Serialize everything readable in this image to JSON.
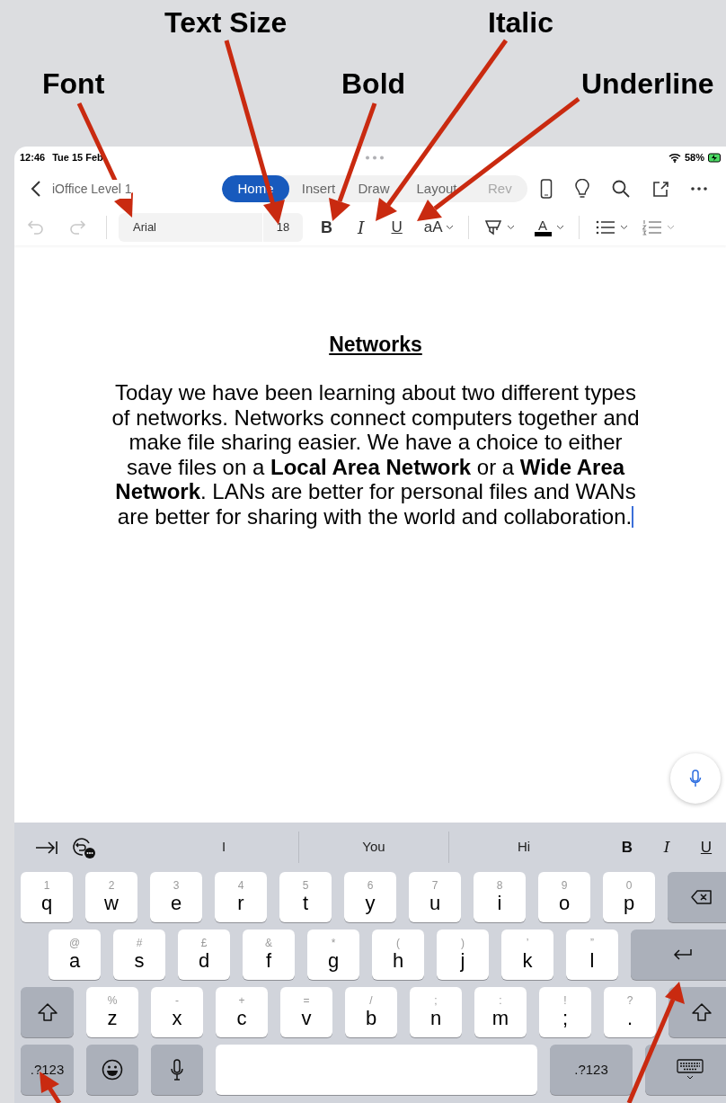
{
  "annotations": [
    {
      "label": "Text Size",
      "kind": "top"
    },
    {
      "label": "Italic",
      "kind": "top"
    },
    {
      "label": "Font",
      "kind": "low"
    },
    {
      "label": "Bold",
      "kind": "low"
    },
    {
      "label": "Underline",
      "kind": "low"
    }
  ],
  "status_bar": {
    "time": "12:46",
    "date": "Tue 15 Feb",
    "battery": "58%"
  },
  "title_bar": {
    "document_title": "iOffice Level 1",
    "tabs": [
      {
        "label": "Home",
        "selected": true
      },
      {
        "label": "Insert",
        "selected": false
      },
      {
        "label": "Draw",
        "selected": false
      },
      {
        "label": "Layout",
        "selected": false
      },
      {
        "label": "Rev",
        "selected": false
      }
    ]
  },
  "toolbar": {
    "font": "Arial",
    "size": "18",
    "bold": "B",
    "italic": "I",
    "underline": "U",
    "change_case": "aA",
    "font_color": "A"
  },
  "document": {
    "heading": "Networks",
    "paragraph": "Today we have been learning about two different types of networks. Networks connect computers together and make file sharing easier. We have a choice to either save files on a **Local Area Network** or a **Wide Area Network**. LANs are better for personal files and WANs are better for sharing with the world and collaboration."
  },
  "keyboard": {
    "suggestions": [
      "I",
      "You",
      "Hi"
    ],
    "format": [
      "B",
      "I",
      "U"
    ],
    "rows": [
      [
        {
          "kind": "letter",
          "label": "q",
          "hint": "1"
        },
        {
          "kind": "letter",
          "label": "w",
          "hint": "2"
        },
        {
          "kind": "letter",
          "label": "e",
          "hint": "3"
        },
        {
          "kind": "letter",
          "label": "r",
          "hint": "4"
        },
        {
          "kind": "letter",
          "label": "t",
          "hint": "5"
        },
        {
          "kind": "letter",
          "label": "y",
          "hint": "6"
        },
        {
          "kind": "letter",
          "label": "u",
          "hint": "7"
        },
        {
          "kind": "letter",
          "label": "i",
          "hint": "8"
        },
        {
          "kind": "letter",
          "label": "o",
          "hint": "9"
        },
        {
          "kind": "letter",
          "label": "p",
          "hint": "0"
        },
        {
          "kind": "backspace"
        }
      ],
      [
        {
          "kind": "letter",
          "label": "a",
          "hint": "@"
        },
        {
          "kind": "letter",
          "label": "s",
          "hint": "#"
        },
        {
          "kind": "letter",
          "label": "d",
          "hint": "£"
        },
        {
          "kind": "letter",
          "label": "f",
          "hint": "&"
        },
        {
          "kind": "letter",
          "label": "g",
          "hint": "*"
        },
        {
          "kind": "letter",
          "label": "h",
          "hint": "("
        },
        {
          "kind": "letter",
          "label": "j",
          "hint": ")"
        },
        {
          "kind": "letter",
          "label": "k",
          "hint": "’"
        },
        {
          "kind": "letter",
          "label": "l",
          "hint": "”"
        },
        {
          "kind": "return"
        }
      ],
      [
        {
          "kind": "shift"
        },
        {
          "kind": "letter",
          "label": "z",
          "hint": "%"
        },
        {
          "kind": "letter",
          "label": "x",
          "hint": "-"
        },
        {
          "kind": "letter",
          "label": "c",
          "hint": "+"
        },
        {
          "kind": "letter",
          "label": "v",
          "hint": "="
        },
        {
          "kind": "letter",
          "label": "b",
          "hint": "/"
        },
        {
          "kind": "letter",
          "label": "n",
          "hint": ";"
        },
        {
          "kind": "letter",
          "label": "m",
          "hint": ":"
        },
        {
          "kind": "letter",
          "label": ";",
          "hint": "!"
        },
        {
          "kind": "letter",
          "label": ".",
          "hint": "?"
        },
        {
          "kind": "shift"
        }
      ],
      [
        {
          "kind": "mode",
          "label": ".?123"
        },
        {
          "kind": "emoji"
        },
        {
          "kind": "dictation"
        },
        {
          "kind": "space"
        },
        {
          "kind": "mode",
          "label": ".?123"
        },
        {
          "kind": "hide"
        }
      ]
    ]
  }
}
